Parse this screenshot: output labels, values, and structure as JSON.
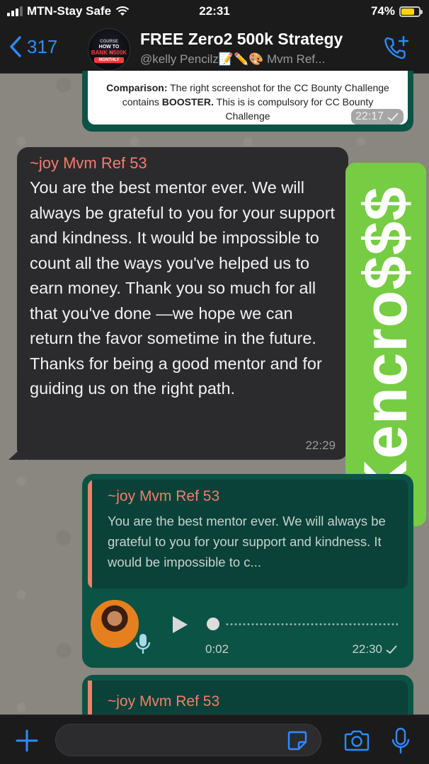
{
  "status_bar": {
    "carrier": "MTN-Stay Safe",
    "time": "22:31",
    "battery": "74%",
    "battery_level": 0.74
  },
  "header": {
    "back_count": "317",
    "title": "FREE Zero2 500k Strategy",
    "subtitle": "@kelly Pencilz📝✏️🎨 Mvm Ref...",
    "avatar_text": {
      "line1": "COURSE",
      "line2": "HOW TO",
      "line3": "BANK ₦500K",
      "line4": "MONTHLY"
    },
    "icons": {
      "back": "chevron-left-icon",
      "call": "add-call-icon"
    }
  },
  "messages": {
    "top_image": {
      "label": "Comparison:",
      "text_1": " The right screenshot for the CC Bounty Challenge contains ",
      "bold": "BOOSTER.",
      "text_2": " This is is compulsory for CC Bounty Challenge",
      "time": "22:17"
    },
    "incoming": {
      "sender": "~joy Mvm Ref 53",
      "text": "You are the best mentor ever. We will always be grateful to you for your support and kindness. It would be impossible to count all the ways you've helped us to earn money. Thank you so much for all that you've done —we hope we can return the favor sometime in the future. Thanks for being a good mentor and for guiding us on the right path.",
      "time": "22:29"
    },
    "reply_voice": {
      "quoted_sender": "~joy Mvm Ref 53",
      "quoted_text": "You are the best mentor ever. We will always be grateful to you for your support and kindness. It would be impossible to c...",
      "duration": "0:02",
      "time": "22:30"
    },
    "bottom_partial": {
      "quoted_sender": "~joy Mvm Ref 53"
    }
  },
  "watermark": {
    "text": "Kencro$$$",
    "color": "#76cc43"
  },
  "colors": {
    "accent_blue": "#2d8cff",
    "outgoing_bubble": "#0b5345",
    "incoming_bubble": "#2b2b2d",
    "sender_name": "#f07f6e"
  },
  "input_bar": {
    "icons": [
      "plus-icon",
      "sticker-icon",
      "camera-icon",
      "microphone-icon"
    ]
  }
}
